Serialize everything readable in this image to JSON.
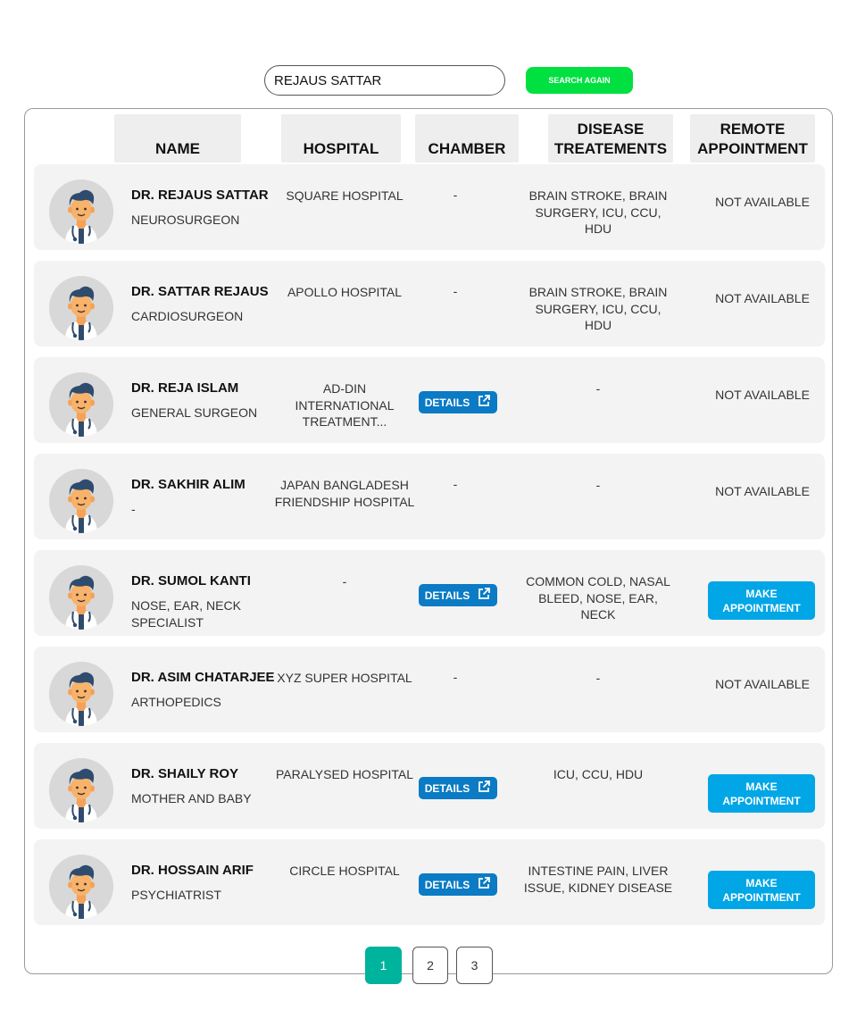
{
  "search": {
    "value": "REJAUS SATTAR",
    "button_label": "SEARCH AGAIN"
  },
  "columns": {
    "name": "NAME",
    "hospital": "HOSPITAL",
    "chamber": "CHAMBER",
    "disease": "DISEASE TREATEMENTS",
    "remote": "REMOTE APPOINTMENT"
  },
  "labels": {
    "details": "DETAILS",
    "make_appointment": "MAKE APPOINTMENT",
    "not_available": "NOT AVAILABLE"
  },
  "doctors": [
    {
      "name": "DR. REJAUS SATTAR",
      "specialty": "NEUROSURGEON",
      "hospital": "SQUARE HOSPITAL",
      "chamber": "-",
      "disease": "BRAIN STROKE, BRAIN SURGERY, ICU, CCU, HDU",
      "remote": "NOT AVAILABLE"
    },
    {
      "name": "DR. SATTAR REJAUS",
      "specialty": "CARDIOSURGEON",
      "hospital": "APOLLO HOSPITAL",
      "chamber": "-",
      "disease": "BRAIN STROKE, BRAIN SURGERY, ICU, CCU, HDU",
      "remote": "NOT AVAILABLE"
    },
    {
      "name": "DR. REJA ISLAM",
      "specialty": "GENERAL SURGEON",
      "hospital": "AD-DIN INTERNATIONAL TREATMENT...",
      "chamber": "DETAILS",
      "disease": "-",
      "remote": "NOT AVAILABLE"
    },
    {
      "name": "DR. SAKHIR ALIM",
      "specialty": "-",
      "hospital": "JAPAN BANGLADESH FRIENDSHIP HOSPITAL",
      "chamber": "-",
      "disease": "-",
      "remote": "NOT AVAILABLE"
    },
    {
      "name": "DR. SUMOL KANTI",
      "specialty": "NOSE, EAR, NECK SPECIALIST",
      "hospital": "-",
      "chamber": "DETAILS",
      "disease": "COMMON COLD, NASAL BLEED, NOSE, EAR, NECK",
      "remote": "MAKE APPOINTMENT"
    },
    {
      "name": "DR. ASIM CHATARJEE",
      "specialty": "ARTHOPEDICS",
      "hospital": "XYZ SUPER HOSPITAL",
      "chamber": "-",
      "disease": "-",
      "remote": "NOT AVAILABLE"
    },
    {
      "name": "DR. SHAILY ROY",
      "specialty": "MOTHER AND BABY",
      "hospital": "PARALYSED HOSPITAL",
      "chamber": "DETAILS",
      "disease": "ICU, CCU, HDU",
      "remote": "MAKE APPOINTMENT"
    },
    {
      "name": "DR. HOSSAIN ARIF",
      "specialty": "PSYCHIATRIST",
      "hospital": "CIRCLE HOSPITAL",
      "chamber": "DETAILS",
      "disease": "INTESTINE PAIN, LIVER ISSUE, KIDNEY DISEASE",
      "remote": "MAKE APPOINTMENT"
    }
  ],
  "pagination": {
    "pages": [
      "1",
      "2",
      "3"
    ],
    "current": "1"
  },
  "colors": {
    "search_button": "#00e040",
    "details_button": "#0a7bc4",
    "appointment_button": "#00a6e6",
    "active_page": "#00b39c",
    "row_bg": "#f3f3f3",
    "header_bg": "#eeeeee"
  }
}
